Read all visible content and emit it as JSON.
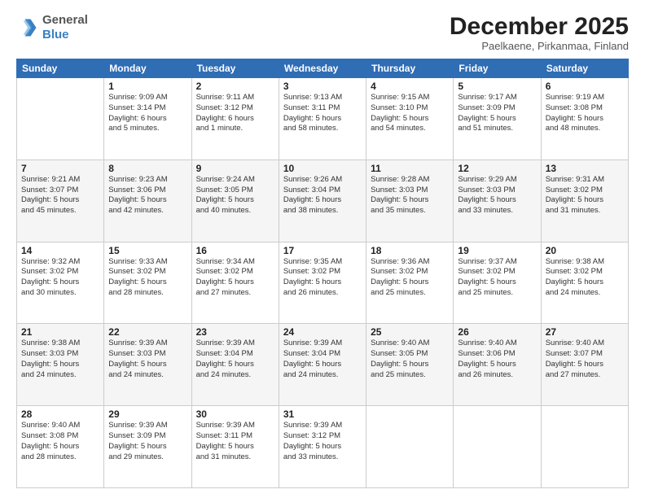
{
  "header": {
    "logo": {
      "general": "General",
      "blue": "Blue"
    },
    "title": "December 2025",
    "subtitle": "Paelkaene, Pirkanmaa, Finland"
  },
  "days_of_week": [
    "Sunday",
    "Monday",
    "Tuesday",
    "Wednesday",
    "Thursday",
    "Friday",
    "Saturday"
  ],
  "weeks": [
    [
      {
        "day": "",
        "info": ""
      },
      {
        "day": "1",
        "info": "Sunrise: 9:09 AM\nSunset: 3:14 PM\nDaylight: 6 hours\nand 5 minutes."
      },
      {
        "day": "2",
        "info": "Sunrise: 9:11 AM\nSunset: 3:12 PM\nDaylight: 6 hours\nand 1 minute."
      },
      {
        "day": "3",
        "info": "Sunrise: 9:13 AM\nSunset: 3:11 PM\nDaylight: 5 hours\nand 58 minutes."
      },
      {
        "day": "4",
        "info": "Sunrise: 9:15 AM\nSunset: 3:10 PM\nDaylight: 5 hours\nand 54 minutes."
      },
      {
        "day": "5",
        "info": "Sunrise: 9:17 AM\nSunset: 3:09 PM\nDaylight: 5 hours\nand 51 minutes."
      },
      {
        "day": "6",
        "info": "Sunrise: 9:19 AM\nSunset: 3:08 PM\nDaylight: 5 hours\nand 48 minutes."
      }
    ],
    [
      {
        "day": "7",
        "info": "Sunrise: 9:21 AM\nSunset: 3:07 PM\nDaylight: 5 hours\nand 45 minutes."
      },
      {
        "day": "8",
        "info": "Sunrise: 9:23 AM\nSunset: 3:06 PM\nDaylight: 5 hours\nand 42 minutes."
      },
      {
        "day": "9",
        "info": "Sunrise: 9:24 AM\nSunset: 3:05 PM\nDaylight: 5 hours\nand 40 minutes."
      },
      {
        "day": "10",
        "info": "Sunrise: 9:26 AM\nSunset: 3:04 PM\nDaylight: 5 hours\nand 38 minutes."
      },
      {
        "day": "11",
        "info": "Sunrise: 9:28 AM\nSunset: 3:03 PM\nDaylight: 5 hours\nand 35 minutes."
      },
      {
        "day": "12",
        "info": "Sunrise: 9:29 AM\nSunset: 3:03 PM\nDaylight: 5 hours\nand 33 minutes."
      },
      {
        "day": "13",
        "info": "Sunrise: 9:31 AM\nSunset: 3:02 PM\nDaylight: 5 hours\nand 31 minutes."
      }
    ],
    [
      {
        "day": "14",
        "info": "Sunrise: 9:32 AM\nSunset: 3:02 PM\nDaylight: 5 hours\nand 30 minutes."
      },
      {
        "day": "15",
        "info": "Sunrise: 9:33 AM\nSunset: 3:02 PM\nDaylight: 5 hours\nand 28 minutes."
      },
      {
        "day": "16",
        "info": "Sunrise: 9:34 AM\nSunset: 3:02 PM\nDaylight: 5 hours\nand 27 minutes."
      },
      {
        "day": "17",
        "info": "Sunrise: 9:35 AM\nSunset: 3:02 PM\nDaylight: 5 hours\nand 26 minutes."
      },
      {
        "day": "18",
        "info": "Sunrise: 9:36 AM\nSunset: 3:02 PM\nDaylight: 5 hours\nand 25 minutes."
      },
      {
        "day": "19",
        "info": "Sunrise: 9:37 AM\nSunset: 3:02 PM\nDaylight: 5 hours\nand 25 minutes."
      },
      {
        "day": "20",
        "info": "Sunrise: 9:38 AM\nSunset: 3:02 PM\nDaylight: 5 hours\nand 24 minutes."
      }
    ],
    [
      {
        "day": "21",
        "info": "Sunrise: 9:38 AM\nSunset: 3:03 PM\nDaylight: 5 hours\nand 24 minutes."
      },
      {
        "day": "22",
        "info": "Sunrise: 9:39 AM\nSunset: 3:03 PM\nDaylight: 5 hours\nand 24 minutes."
      },
      {
        "day": "23",
        "info": "Sunrise: 9:39 AM\nSunset: 3:04 PM\nDaylight: 5 hours\nand 24 minutes."
      },
      {
        "day": "24",
        "info": "Sunrise: 9:39 AM\nSunset: 3:04 PM\nDaylight: 5 hours\nand 24 minutes."
      },
      {
        "day": "25",
        "info": "Sunrise: 9:40 AM\nSunset: 3:05 PM\nDaylight: 5 hours\nand 25 minutes."
      },
      {
        "day": "26",
        "info": "Sunrise: 9:40 AM\nSunset: 3:06 PM\nDaylight: 5 hours\nand 26 minutes."
      },
      {
        "day": "27",
        "info": "Sunrise: 9:40 AM\nSunset: 3:07 PM\nDaylight: 5 hours\nand 27 minutes."
      }
    ],
    [
      {
        "day": "28",
        "info": "Sunrise: 9:40 AM\nSunset: 3:08 PM\nDaylight: 5 hours\nand 28 minutes."
      },
      {
        "day": "29",
        "info": "Sunrise: 9:39 AM\nSunset: 3:09 PM\nDaylight: 5 hours\nand 29 minutes."
      },
      {
        "day": "30",
        "info": "Sunrise: 9:39 AM\nSunset: 3:11 PM\nDaylight: 5 hours\nand 31 minutes."
      },
      {
        "day": "31",
        "info": "Sunrise: 9:39 AM\nSunset: 3:12 PM\nDaylight: 5 hours\nand 33 minutes."
      },
      {
        "day": "",
        "info": ""
      },
      {
        "day": "",
        "info": ""
      },
      {
        "day": "",
        "info": ""
      }
    ]
  ]
}
